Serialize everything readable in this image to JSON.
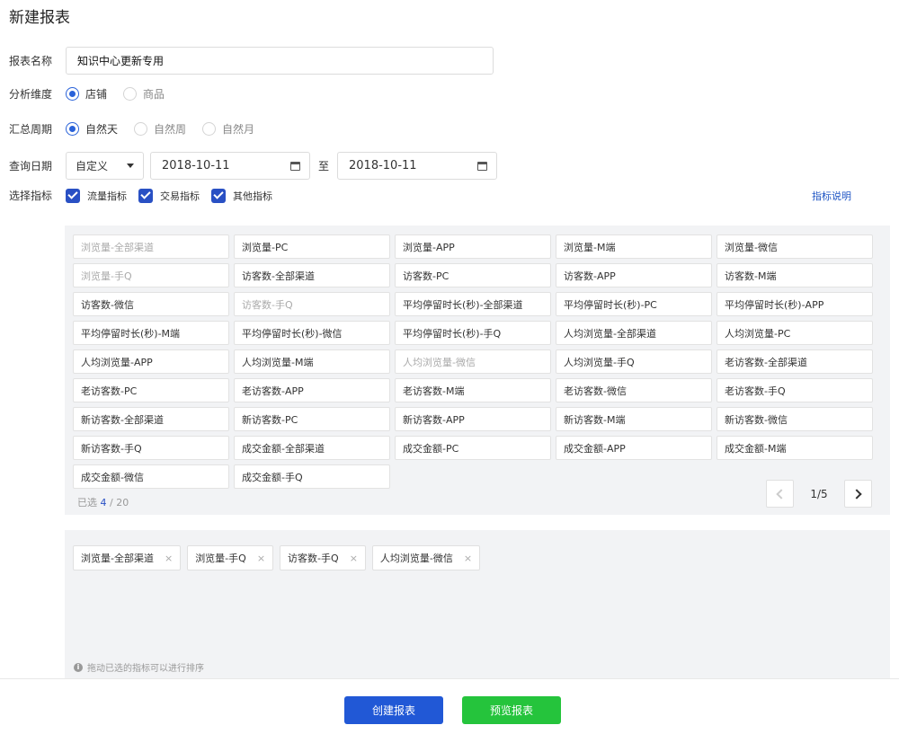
{
  "page": {
    "title": "新建报表"
  },
  "form": {
    "name_label": "报表名称",
    "name_value": "知识中心更新专用",
    "dimension_label": "分析维度",
    "dimension_options": [
      "店铺",
      "商品"
    ],
    "period_label": "汇总周期",
    "period_options": [
      "自然天",
      "自然周",
      "自然月"
    ],
    "date_label": "查询日期",
    "date_mode": "自定义",
    "date_start": "2018-10-11",
    "date_sep": "至",
    "date_end": "2018-10-11",
    "metric_label": "选择指标",
    "metric_groups": [
      "流量指标",
      "交易指标",
      "其他指标"
    ],
    "metric_help": "指标说明"
  },
  "metrics": [
    "浏览量-全部渠道",
    "浏览量-PC",
    "浏览量-APP",
    "浏览量-M端",
    "浏览量-微信",
    "浏览量-手Q",
    "访客数-全部渠道",
    "访客数-PC",
    "访客数-APP",
    "访客数-M端",
    "访客数-微信",
    "访客数-手Q",
    "平均停留时长(秒)-全部渠道",
    "平均停留时长(秒)-PC",
    "平均停留时长(秒)-APP",
    "平均停留时长(秒)-M端",
    "平均停留时长(秒)-微信",
    "平均停留时长(秒)-手Q",
    "人均浏览量-全部渠道",
    "人均浏览量-PC",
    "人均浏览量-APP",
    "人均浏览量-M端",
    "人均浏览量-微信",
    "人均浏览量-手Q",
    "老访客数-全部渠道",
    "老访客数-PC",
    "老访客数-APP",
    "老访客数-M端",
    "老访客数-微信",
    "老访客数-手Q",
    "新访客数-全部渠道",
    "新访客数-PC",
    "新访客数-APP",
    "新访客数-M端",
    "新访客数-微信",
    "新访客数-手Q",
    "成交金额-全部渠道",
    "成交金额-PC",
    "成交金额-APP",
    "成交金额-M端",
    "成交金额-微信",
    "成交金额-手Q"
  ],
  "selection": {
    "prefix": "已选",
    "count": "4",
    "total": "/ 20"
  },
  "pager": {
    "text": "1/5"
  },
  "selected_tags": [
    "浏览量-全部渠道",
    "浏览量-手Q",
    "访客数-手Q",
    "人均浏览量-微信"
  ],
  "hint": "拖动已选的指标可以进行排序",
  "footer": {
    "create_label": "创建报表",
    "preview_label": "预览报表"
  },
  "colors": {
    "primary": "#2158d6",
    "success": "#25c43c",
    "checkbox": "#2950c4"
  }
}
